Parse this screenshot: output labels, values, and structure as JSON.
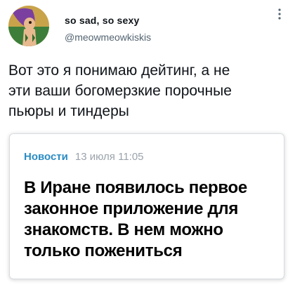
{
  "user": {
    "display_name": "so sad, so sexy",
    "handle": "@meowmeowkiskis",
    "avatar_icon": "cartoon-character-avatar-icon"
  },
  "tweet": {
    "text_lines": [
      "Вот это я понимаю дейтинг, а не",
      "эти ваши богомерзкие порочные",
      "пьюры и тиндеры"
    ]
  },
  "card": {
    "section": "Новости",
    "date": "13 июля 11:05",
    "headline_lines": [
      "В Иране появилось первое",
      "законное приложение для",
      "знакомств. В нем можно",
      "только пожениться"
    ]
  },
  "colors": {
    "section_link": "#2b8cc4",
    "handle_gray": "#536471",
    "date_gray": "#9ba3ab"
  },
  "icons": {
    "more": "more-vertical-icon"
  }
}
